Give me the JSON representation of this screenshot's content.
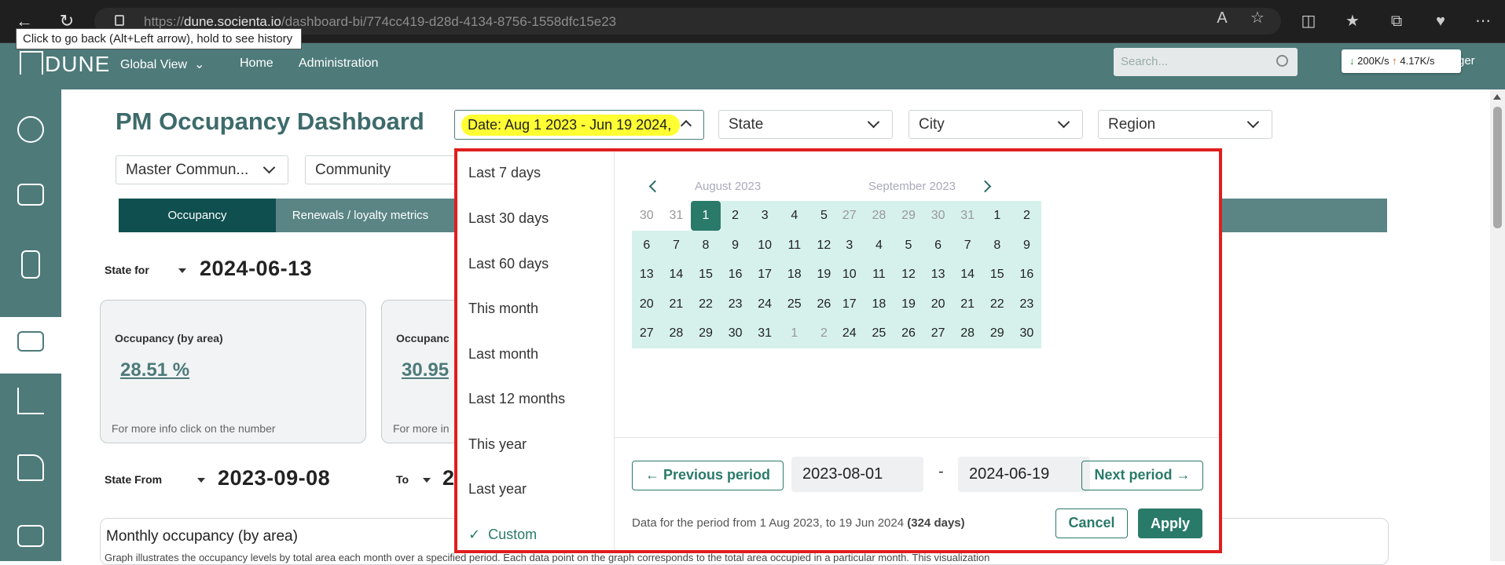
{
  "browser": {
    "url_prefix": "https://",
    "url_host": "dune.socienta.io",
    "url_path": "/dashboard-bi/774cc419-d28d-4134-8756-1558dfc15e23",
    "tooltip": "Click to go back (Alt+Left arrow), hold to see history"
  },
  "header": {
    "logo": "DUNE",
    "nav": [
      "Global View",
      "Home",
      "Administration"
    ],
    "search_placeholder": "Search...",
    "net_down": "200K/s",
    "net_up": "4.17K/s",
    "user_fragment": "ger"
  },
  "sidebar": {
    "icons": [
      "globe-icon",
      "presentation-icon",
      "building-icon",
      "wallet-icon",
      "chart-icon",
      "money-hand-icon",
      "cards-icon"
    ]
  },
  "dashboard": {
    "title": "PM Occupancy Dashboard",
    "filters": {
      "date": "Date: Aug 1 2023 - Jun 19 2024,",
      "state": "State",
      "city": "City",
      "region": "Region",
      "master_community": "Master Commun...",
      "community": "Community"
    },
    "tabs": [
      "Occupancy",
      "Renewals / loyalty metrics"
    ],
    "state_for_label": "State for",
    "state_for_date": "2024-06-13",
    "cards": [
      {
        "title": "Occupancy (by area)",
        "value": "28.51 %",
        "footer": "For more info click on the number"
      },
      {
        "title": "Occupanc",
        "value": "30.95",
        "footer": "For more in"
      }
    ],
    "state_from_label": "State From",
    "state_from_date": "2023-09-08",
    "to_label": "To",
    "to_date_fragment": "2",
    "monthly_title": "Monthly occupancy (by area)",
    "monthly_desc": "Graph illustrates the occupancy levels by total area each month over a specified period. Each data point on the graph corresponds to the total area occupied in a particular month. This visualization"
  },
  "datepicker": {
    "presets": [
      "Last 7 days",
      "Last 30 days",
      "Last 60 days",
      "This month",
      "Last month",
      "Last 12 months",
      "This year",
      "Last year",
      "Custom"
    ],
    "selected_preset": "Custom",
    "months": [
      {
        "header": "August  2023",
        "days": [
          "30",
          "31",
          "1",
          "2",
          "3",
          "4",
          "5",
          "6",
          "7",
          "8",
          "9",
          "10",
          "11",
          "12",
          "13",
          "14",
          "15",
          "16",
          "17",
          "18",
          "19",
          "20",
          "21",
          "22",
          "23",
          "24",
          "25",
          "26",
          "27",
          "28",
          "29",
          "30",
          "31",
          "1",
          "2"
        ],
        "out_days": [
          0,
          1,
          33,
          34
        ],
        "range_start": 2,
        "range_end": 34,
        "selected": 2
      },
      {
        "header": "September  2023",
        "days": [
          "27",
          "28",
          "29",
          "30",
          "31",
          "1",
          "2",
          "3",
          "4",
          "5",
          "6",
          "7",
          "8",
          "9",
          "10",
          "11",
          "12",
          "13",
          "14",
          "15",
          "16",
          "17",
          "18",
          "19",
          "20",
          "21",
          "22",
          "23",
          "24",
          "25",
          "26",
          "27",
          "28",
          "29",
          "30"
        ],
        "out_days": [
          0,
          1,
          2,
          3,
          4
        ],
        "range_start": 0,
        "range_end": 34,
        "selected": -1
      }
    ],
    "prev_period": "Previous period",
    "next_period": "Next period",
    "start_value": "2023-08-01",
    "end_value": "2024-06-19",
    "separator": "-",
    "note_text": "Data for the period from 1 Aug 2023, to 19 Jun 2024",
    "note_days": "(324 days)",
    "cancel": "Cancel",
    "apply": "Apply"
  },
  "colors": {
    "brand": "#4e7a7a",
    "accent": "#2a7a6a",
    "highlight": "#ffff33",
    "annotation": "#e01e1e"
  }
}
